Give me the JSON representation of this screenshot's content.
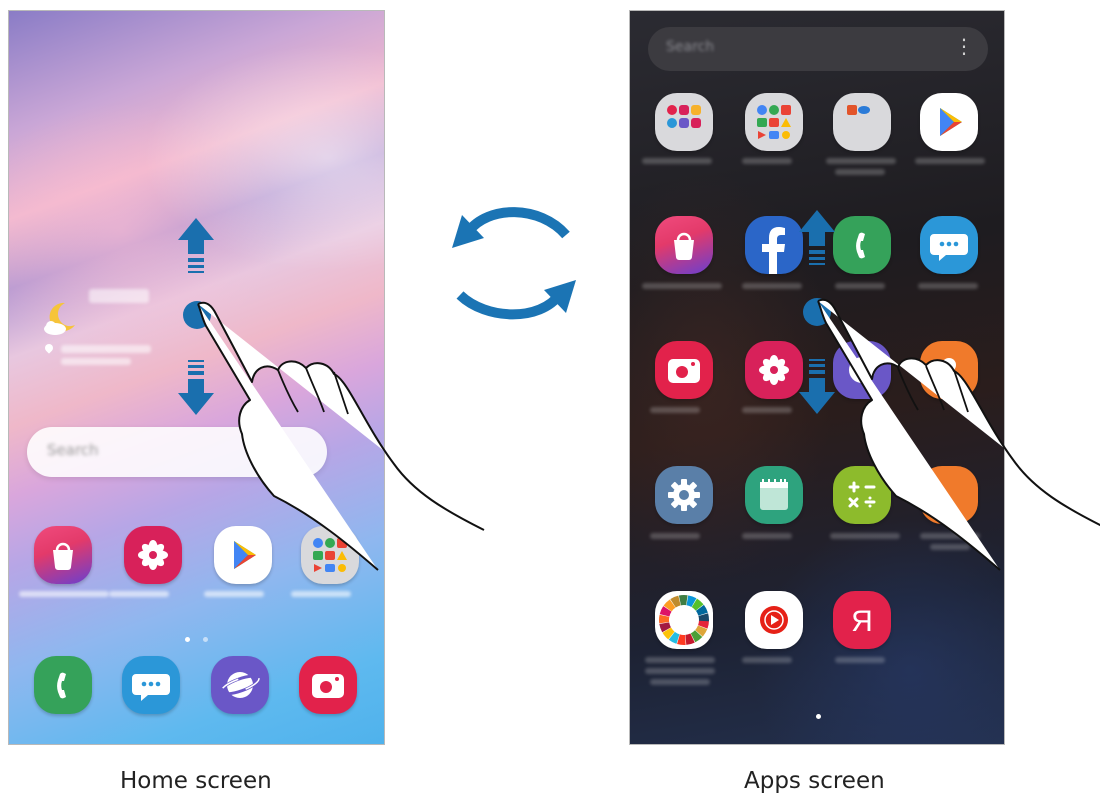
{
  "home": {
    "caption": "Home screen",
    "search_placeholder": "Search",
    "icons": [
      "galaxy-store-icon",
      "gallery-icon",
      "play-store-icon",
      "google-folder-icon"
    ],
    "dock": [
      "phone-icon",
      "messages-icon",
      "internet-icon",
      "camera-icon"
    ]
  },
  "apps": {
    "caption": "Apps screen",
    "search_placeholder": "Search",
    "menu": "⋮"
  },
  "colors": {
    "arrow_blue": "#1a6fae",
    "cycle_blue": "#1b74b4"
  }
}
